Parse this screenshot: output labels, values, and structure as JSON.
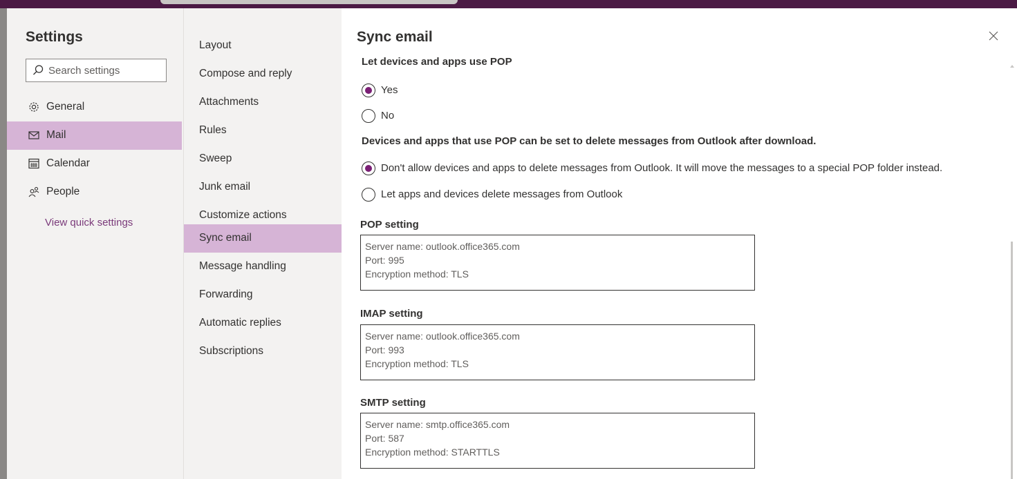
{
  "settings": {
    "title": "Settings",
    "search_placeholder": "Search settings",
    "nav": [
      {
        "label": "General",
        "icon": "gear-icon"
      },
      {
        "label": "Mail",
        "icon": "mail-icon",
        "active": true
      },
      {
        "label": "Calendar",
        "icon": "calendar-icon"
      },
      {
        "label": "People",
        "icon": "people-icon"
      }
    ],
    "quick_settings_label": "View quick settings"
  },
  "mail_nav": [
    "Layout",
    "Compose and reply",
    "Attachments",
    "Rules",
    "Sweep",
    "Junk email",
    "Customize actions",
    "Sync email",
    "Message handling",
    "Forwarding",
    "Automatic replies",
    "Subscriptions"
  ],
  "mail_nav_active": "Sync email",
  "main": {
    "title": "Sync email",
    "pop_access": {
      "heading": "Let devices and apps use POP",
      "options": [
        "Yes",
        "No"
      ],
      "selected": "Yes"
    },
    "pop_delete": {
      "heading": "Devices and apps that use POP can be set to delete messages from Outlook after download.",
      "options": [
        "Don't allow devices and apps to delete messages from Outlook. It will move the messages to a special POP folder instead.",
        "Let apps and devices delete messages from Outlook"
      ],
      "selected": 0
    },
    "pop_setting": {
      "label": "POP setting",
      "lines": [
        "Server name: outlook.office365.com",
        "Port: 995",
        "Encryption method: TLS"
      ]
    },
    "imap_setting": {
      "label": "IMAP setting",
      "lines": [
        "Server name: outlook.office365.com",
        "Port: 993",
        "Encryption method: TLS"
      ]
    },
    "smtp_setting": {
      "label": "SMTP setting",
      "lines": [
        "Server name: smtp.office365.com",
        "Port: 587",
        "Encryption method: STARTTLS"
      ]
    }
  },
  "colors": {
    "accent": "#7a1f75",
    "selected_bg": "#d6b4d6",
    "topbar": "#4b1a44"
  }
}
